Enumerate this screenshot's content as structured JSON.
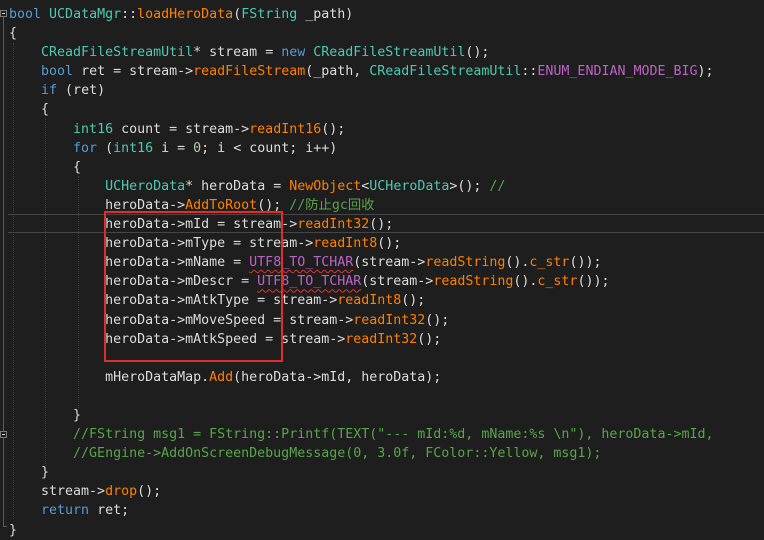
{
  "editor": {
    "lines": [
      {
        "tokens": [
          [
            "kw",
            "bool"
          ],
          [
            "tx",
            " "
          ],
          [
            "ty",
            "UCDataMgr"
          ],
          [
            "tx",
            "::"
          ],
          [
            "fn",
            "loadHeroData"
          ],
          [
            "tx",
            "("
          ],
          [
            "ty",
            "FString"
          ],
          [
            "tx",
            " _path)"
          ]
        ]
      },
      {
        "tokens": [
          [
            "tx",
            "{"
          ]
        ]
      },
      {
        "tokens": [
          [
            "tx",
            "    "
          ],
          [
            "ty",
            "CReadFileStreamUtil"
          ],
          [
            "tx",
            "* stream = "
          ],
          [
            "kw",
            "new"
          ],
          [
            "tx",
            " "
          ],
          [
            "ty",
            "CReadFileStreamUtil"
          ],
          [
            "tx",
            "();"
          ]
        ]
      },
      {
        "tokens": [
          [
            "tx",
            "    "
          ],
          [
            "kw",
            "bool"
          ],
          [
            "tx",
            " ret = stream->"
          ],
          [
            "fn",
            "readFileStream"
          ],
          [
            "tx",
            "(_path, "
          ],
          [
            "ty",
            "CReadFileStreamUtil"
          ],
          [
            "tx",
            "::"
          ],
          [
            "mc",
            "ENUM_ENDIAN_MODE_BIG"
          ],
          [
            "tx",
            ");"
          ]
        ]
      },
      {
        "tokens": [
          [
            "tx",
            "    "
          ],
          [
            "kw",
            "if"
          ],
          [
            "tx",
            " (ret)"
          ]
        ]
      },
      {
        "tokens": [
          [
            "tx",
            "    {"
          ]
        ]
      },
      {
        "tokens": [
          [
            "tx",
            "        "
          ],
          [
            "ty",
            "int16"
          ],
          [
            "tx",
            " count = stream->"
          ],
          [
            "fn",
            "readInt16"
          ],
          [
            "tx",
            "();"
          ]
        ]
      },
      {
        "tokens": [
          [
            "tx",
            "        "
          ],
          [
            "kw",
            "for"
          ],
          [
            "tx",
            " ("
          ],
          [
            "ty",
            "int16"
          ],
          [
            "tx",
            " i = "
          ],
          [
            "nm",
            "0"
          ],
          [
            "tx",
            "; i < count; i++)"
          ]
        ]
      },
      {
        "tokens": [
          [
            "tx",
            "        {"
          ]
        ]
      },
      {
        "tokens": [
          [
            "tx",
            "            "
          ],
          [
            "ty",
            "UCHeroData"
          ],
          [
            "tx",
            "* heroData = "
          ],
          [
            "fn",
            "NewObject"
          ],
          [
            "tx",
            "<"
          ],
          [
            "ty",
            "UCHeroData"
          ],
          [
            "tx",
            ">(); "
          ],
          [
            "cm",
            "//"
          ]
        ]
      },
      {
        "tokens": [
          [
            "tx",
            "            heroData->"
          ],
          [
            "fn",
            "AddToRoot"
          ],
          [
            "tx",
            "(); "
          ],
          [
            "cm",
            "//防止gc回收"
          ]
        ]
      },
      {
        "tokens": [
          [
            "tx",
            "            heroData->mId = stream->"
          ],
          [
            "fn",
            "readInt32"
          ],
          [
            "tx",
            "();"
          ]
        ]
      },
      {
        "tokens": [
          [
            "tx",
            "            heroData->mType = stream->"
          ],
          [
            "fn",
            "readInt8"
          ],
          [
            "tx",
            "();"
          ]
        ]
      },
      {
        "tokens": [
          [
            "tx",
            "            heroData->mName = "
          ],
          [
            "mc squig",
            "UTF8_TO_TCHAR"
          ],
          [
            "tx",
            "(stream->"
          ],
          [
            "fn",
            "readString"
          ],
          [
            "tx",
            "()."
          ],
          [
            "fn",
            "c_str"
          ],
          [
            "tx",
            "());"
          ]
        ]
      },
      {
        "tokens": [
          [
            "tx",
            "            heroData->mDescr = "
          ],
          [
            "mc squig",
            "UTF8_TO_TCHAR"
          ],
          [
            "tx",
            "(stream->"
          ],
          [
            "fn",
            "readString"
          ],
          [
            "tx",
            "()."
          ],
          [
            "fn",
            "c_str"
          ],
          [
            "tx",
            "());"
          ]
        ]
      },
      {
        "tokens": [
          [
            "tx",
            "            heroData->mAtkType = stream->"
          ],
          [
            "fn",
            "readInt8"
          ],
          [
            "tx",
            "();"
          ]
        ]
      },
      {
        "tokens": [
          [
            "tx",
            "            heroData->mMoveSpeed = stream->"
          ],
          [
            "fn",
            "readInt32"
          ],
          [
            "tx",
            "();"
          ]
        ]
      },
      {
        "tokens": [
          [
            "tx",
            "            heroData->mAtkSpeed = stream->"
          ],
          [
            "fn",
            "readInt32"
          ],
          [
            "tx",
            "();"
          ]
        ]
      },
      {
        "tokens": [
          [
            "tx",
            ""
          ]
        ]
      },
      {
        "tokens": [
          [
            "tx",
            "            mHeroDataMap."
          ],
          [
            "fn",
            "Add"
          ],
          [
            "tx",
            "(heroData->mId, heroData);"
          ]
        ]
      },
      {
        "tokens": [
          [
            "tx",
            ""
          ]
        ]
      },
      {
        "tokens": [
          [
            "tx",
            "        }"
          ]
        ]
      },
      {
        "tokens": [
          [
            "cm",
            "        //FString msg1 = FString::Printf(TEXT(\"--- mId:%d, mName:%s \\n\"), heroData->mId,"
          ]
        ]
      },
      {
        "tokens": [
          [
            "cm",
            "        //GEngine->AddOnScreenDebugMessage(0, 3.0f, FColor::Yellow, msg1);"
          ]
        ]
      },
      {
        "tokens": [
          [
            "tx",
            "    }"
          ]
        ]
      },
      {
        "tokens": [
          [
            "tx",
            "    stream->"
          ],
          [
            "fn",
            "drop"
          ],
          [
            "tx",
            "();"
          ]
        ]
      },
      {
        "tokens": [
          [
            "tx",
            "    "
          ],
          [
            "kw",
            "return"
          ],
          [
            "tx",
            " ret;"
          ]
        ]
      },
      {
        "tokens": [
          [
            "tx",
            "}"
          ]
        ]
      }
    ]
  }
}
